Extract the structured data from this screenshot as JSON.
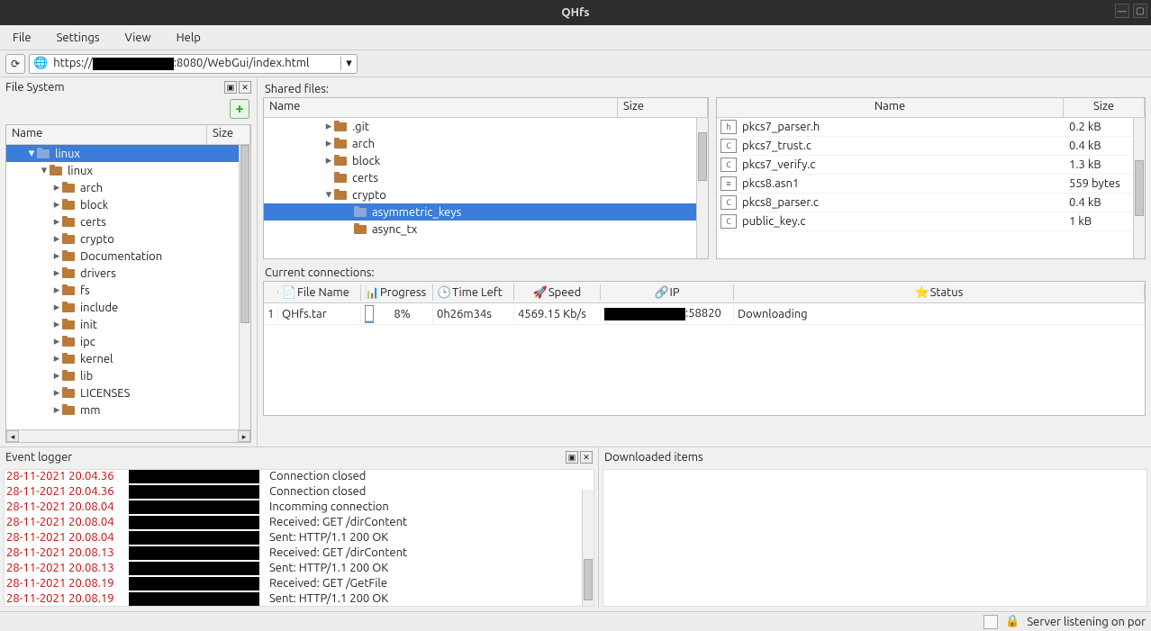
{
  "window": {
    "title": "QHfs"
  },
  "menus": {
    "file": "File",
    "settings": "Settings",
    "view": "View",
    "help": "Help"
  },
  "url": {
    "prefix": "https://",
    "suffix": ":8080/WebGui/index.html"
  },
  "fs": {
    "title": "File System",
    "col_name": "Name",
    "col_size": "Size",
    "root": "linux",
    "items": [
      "linux",
      "arch",
      "block",
      "certs",
      "crypto",
      "Documentation",
      "drivers",
      "fs",
      "include",
      "init",
      "ipc",
      "kernel",
      "lib",
      "LICENSES",
      "mm"
    ]
  },
  "shared": {
    "title": "Shared files:",
    "col_name": "Name",
    "col_size": "Size",
    "tree": [
      {
        "name": ".git",
        "depth": 2,
        "exp": "▸"
      },
      {
        "name": "arch",
        "depth": 2,
        "exp": "▸"
      },
      {
        "name": "block",
        "depth": 2,
        "exp": "▸"
      },
      {
        "name": "certs",
        "depth": 2,
        "exp": ""
      },
      {
        "name": "crypto",
        "depth": 2,
        "exp": "▾"
      },
      {
        "name": "asymmetric_keys",
        "depth": 3,
        "exp": "",
        "sel": true
      },
      {
        "name": "async_tx",
        "depth": 3,
        "exp": ""
      }
    ],
    "files_col_name": "Name",
    "files_col_size": "Size",
    "files": [
      {
        "icon": "h",
        "name": "pkcs7_parser.h",
        "size": "0.2 kB"
      },
      {
        "icon": "C",
        "name": "pkcs7_trust.c",
        "size": "0.4 kB"
      },
      {
        "icon": "C",
        "name": "pkcs7_verify.c",
        "size": "1.3 kB"
      },
      {
        "icon": "≡",
        "name": "pkcs8.asn1",
        "size": "559 bytes"
      },
      {
        "icon": "C",
        "name": "pkcs8_parser.c",
        "size": "0.4 kB"
      },
      {
        "icon": "C",
        "name": "public_key.c",
        "size": "1 kB"
      }
    ]
  },
  "conn": {
    "title": "Current connections:",
    "hdr": {
      "num": "",
      "file": "File Name",
      "prog": "Progress",
      "time": "Time Left",
      "speed": "Speed",
      "ip": "IP",
      "status": "Status"
    },
    "row": {
      "num": "1",
      "file": "QHfs.tar",
      "prog": "8%",
      "time": "0h26m34s",
      "speed": "4569.15 Kb/s",
      "ip_suffix": ":58820",
      "status": "Downloading"
    }
  },
  "evlog": {
    "title": "Event logger",
    "rows": [
      {
        "ts": "28-11-2021 20.04.36",
        "msg": "Connection closed"
      },
      {
        "ts": "28-11-2021 20.04.36",
        "msg": "Connection closed"
      },
      {
        "ts": "28-11-2021 20.08.04",
        "msg": "Incomming connection"
      },
      {
        "ts": "28-11-2021 20.08.04",
        "msg": "Received: GET /dirContent"
      },
      {
        "ts": "28-11-2021 20.08.04",
        "msg": "Sent: HTTP/1.1 200 OK"
      },
      {
        "ts": "28-11-2021 20.08.13",
        "msg": "Received: GET /dirContent"
      },
      {
        "ts": "28-11-2021 20.08.13",
        "msg": "Sent: HTTP/1.1 200 OK"
      },
      {
        "ts": "28-11-2021 20.08.19",
        "msg": "Received: GET /GetFile"
      },
      {
        "ts": "28-11-2021 20.08.19",
        "msg": "Sent: HTTP/1.1 200 OK"
      }
    ]
  },
  "dlitems": {
    "title": "Downloaded items"
  },
  "status": {
    "text": "Server listening on por"
  }
}
